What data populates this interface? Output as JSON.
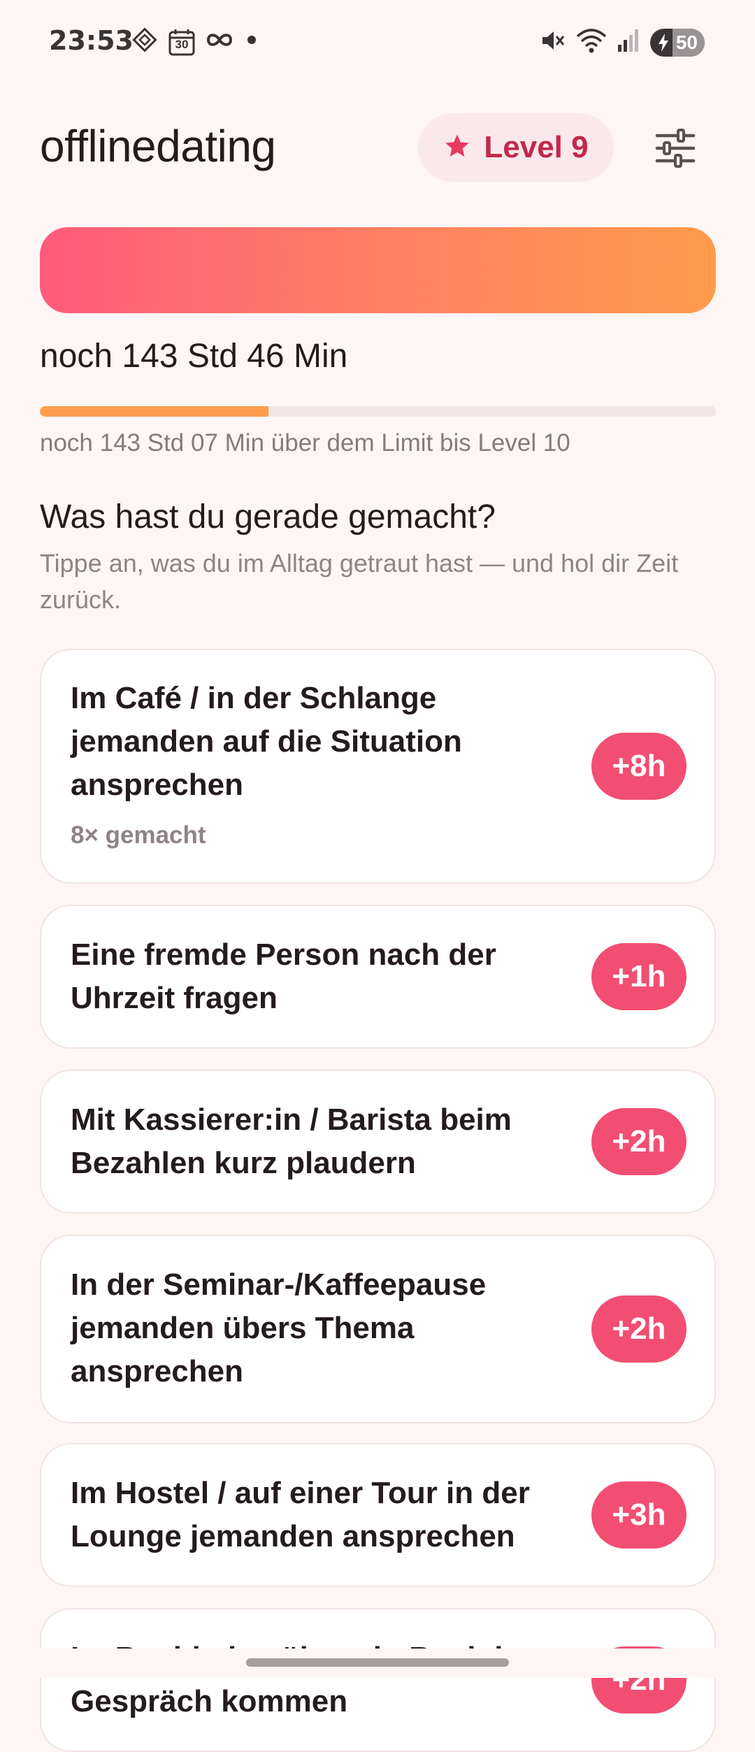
{
  "status_bar": {
    "time": "23:53",
    "battery": "50",
    "left_icons": [
      "diamond-icon",
      "calendar-icon",
      "infinity-icon",
      "dot-icon"
    ],
    "right_icons": [
      "mute-icon",
      "wifi-icon",
      "signal-icon",
      "battery-icon"
    ],
    "calendar_day": "30"
  },
  "header": {
    "title": "offlinedating",
    "level_label": "Level 9",
    "level_icon": "star-icon",
    "settings_icon": "sliders-icon",
    "accent": "#C2284A"
  },
  "progress": {
    "remaining": "noch 143 Std 46 Min",
    "fraction": 0.338,
    "limit_text": "noch 143 Std 07 Min über dem Limit bis Level 10"
  },
  "section": {
    "title": "Was hast du gerade gemacht?",
    "subtitle": "Tippe an, was du im Alltag getraut hast — und hol dir Zeit zurück."
  },
  "actions": [
    {
      "text": "Im Café / in der Schlange jemanden auf die Situation ansprechen",
      "meta": "8× gemacht",
      "badge": "+8h"
    },
    {
      "text": "Eine fremde Person nach der Uhrzeit fragen",
      "meta": "",
      "badge": "+1h"
    },
    {
      "text": "Mit Kassierer:in / Barista beim Bezahlen kurz plaudern",
      "meta": "",
      "badge": "+2h"
    },
    {
      "text": "In der Seminar-/Kaffeepause jemanden übers Thema ansprechen",
      "meta": "",
      "badge": "+2h"
    },
    {
      "text": "Im Hostel / auf einer Tour in der Lounge jemanden ansprechen",
      "meta": "",
      "badge": "+3h"
    },
    {
      "text": "Im Buchladen über ein Buch ins Gespräch kommen",
      "meta": "",
      "badge": "+2h"
    }
  ],
  "colors": {
    "badge": "#F24E72",
    "gradient_start": "#FF5A7C",
    "gradient_end": "#FF9B4C",
    "progress_fill": "#FF9D4D"
  }
}
